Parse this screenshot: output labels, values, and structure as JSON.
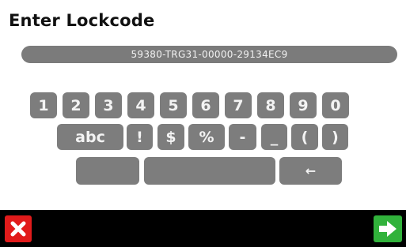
{
  "title": "Enter Lockcode",
  "lockcode_value": "59380-TRG31-00000-29134EC9",
  "keys": {
    "row1": [
      "1",
      "2",
      "3",
      "4",
      "5",
      "6",
      "7",
      "8",
      "9",
      "0"
    ],
    "row2": [
      "abc",
      "!",
      "$",
      "%",
      "-",
      "_",
      "(",
      ")"
    ],
    "row3_backspace": "←"
  },
  "colors": {
    "key": "#7d7d7d",
    "cancel": "#e11b1b",
    "ok": "#31b23b",
    "footer": "#000000"
  },
  "icons": {
    "cancel": "close-icon",
    "ok": "arrow-right-icon",
    "backspace": "backspace-icon"
  }
}
